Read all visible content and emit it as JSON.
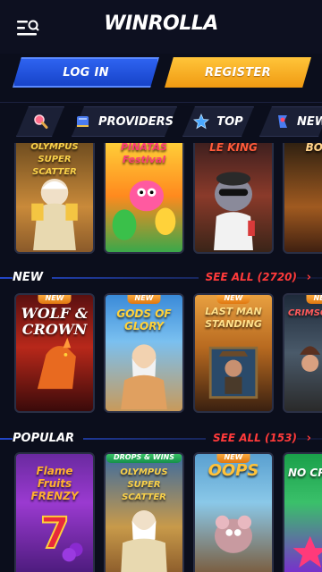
{
  "header": {
    "logo": "WINROLLA"
  },
  "auth": {
    "login_label": "LOG IN",
    "register_label": "REGISTER"
  },
  "tabs": [
    {
      "label": "",
      "icon": "search-icon"
    },
    {
      "label": "PROVIDERS",
      "icon": "book-icon"
    },
    {
      "label": "TOP",
      "icon": "star-icon"
    },
    {
      "label": "NEW",
      "icon": "new-icon"
    }
  ],
  "featured_row": [
    {
      "title": "OLYMPUS SUPER SCATTER"
    },
    {
      "title": "PIÑATAS Festival"
    },
    {
      "title": "LE KING"
    },
    {
      "title": "BOOK"
    }
  ],
  "sections": {
    "new": {
      "title": "NEW",
      "see_all": "SEE ALL (2720)",
      "games": [
        {
          "title": "WOLF & CROWN",
          "badge": "NEW"
        },
        {
          "title": "GODS OF GLORY",
          "badge": "NEW"
        },
        {
          "title": "LAST MAN STANDING",
          "badge": "NEW"
        },
        {
          "title": "CRIMSON",
          "badge": "NEW"
        }
      ]
    },
    "popular": {
      "title": "POPULAR",
      "see_all": "SEE ALL (153)",
      "games": [
        {
          "title": "Flame Fruits FRENZY",
          "badge": ""
        },
        {
          "title": "OLYMPUS SUPER SCATTER",
          "badge": "DROPS & WINS"
        },
        {
          "title": "OOPS",
          "badge": "NEW"
        },
        {
          "title": "NO CR",
          "badge": ""
        }
      ]
    }
  },
  "colors": {
    "login": "#2a5ae8",
    "register": "#f6ac1f",
    "accent_red": "#ff3a3a",
    "bg": "#0b0e1c"
  }
}
